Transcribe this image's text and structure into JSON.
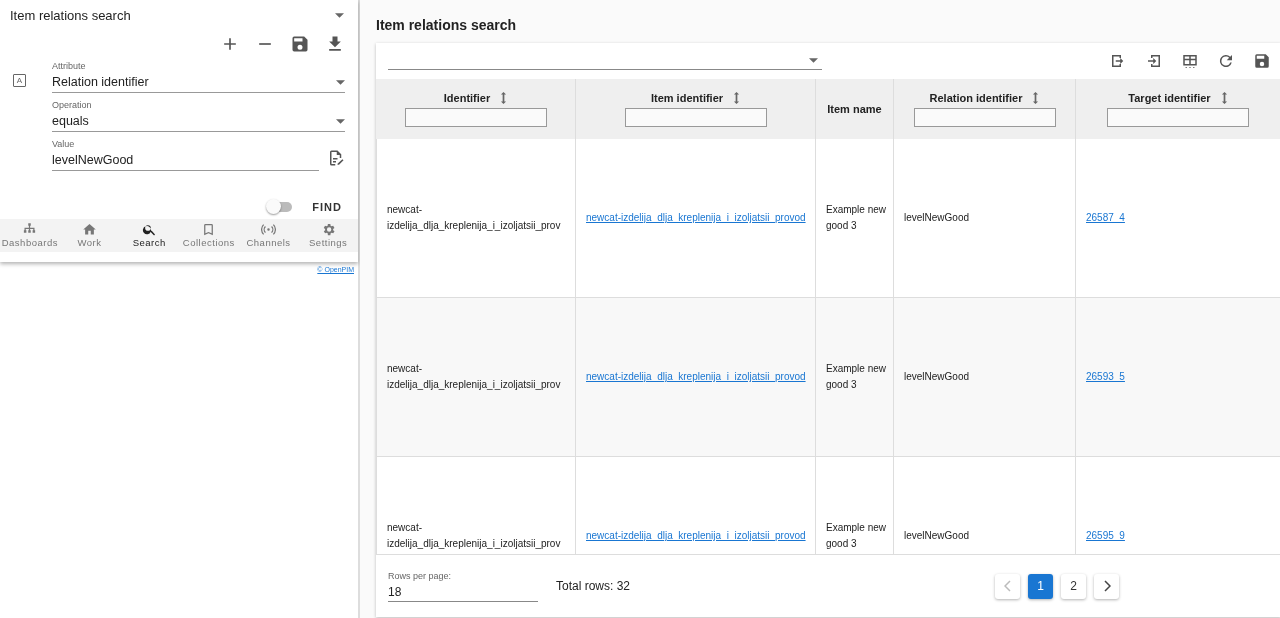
{
  "search_panel": {
    "search_name": "Item relations search",
    "attribute_type_badge": "A",
    "attribute": {
      "label": "Attribute",
      "value": "Relation identifier"
    },
    "operation": {
      "label": "Operation",
      "value": "equals"
    },
    "value_field": {
      "label": "Value",
      "value": "levelNewGood"
    },
    "toggle": {
      "on": false
    },
    "find_button": "FIND"
  },
  "bottom_nav": [
    {
      "label": "Dashboards",
      "kind": "sitemap",
      "selected": false
    },
    {
      "label": "Work",
      "kind": "home",
      "selected": false
    },
    {
      "label": "Search",
      "kind": "search",
      "selected": true
    },
    {
      "label": "Collections",
      "kind": "bookmark",
      "selected": false
    },
    {
      "label": "Channels",
      "kind": "broadcast",
      "selected": false
    },
    {
      "label": "Settings",
      "kind": "gear",
      "selected": false
    }
  ],
  "copyright": "© OpenPIM",
  "main": {
    "title": "Item relations search",
    "columns": [
      {
        "label": "Identifier",
        "sortable": true,
        "filter": true
      },
      {
        "label": "Item identifier",
        "sortable": true,
        "filter": true
      },
      {
        "label": "Item name",
        "sortable": false,
        "filter": false
      },
      {
        "label": "Relation identifier",
        "sortable": true,
        "filter": true
      },
      {
        "label": "Target identifier",
        "sortable": true,
        "filter": true
      }
    ],
    "rows": [
      {
        "identifier": "newcat-izdelija_dlja_kreplenija_i_izoljatsii_prov",
        "item_identifier": "newcat-izdelija_dlja_kreplenija_i_izoljatsii_provod",
        "item_name": "Example new good 3",
        "relation_identifier": "levelNewGood",
        "target_identifier": "26587_4"
      },
      {
        "identifier": "newcat-izdelija_dlja_kreplenija_i_izoljatsii_prov",
        "item_identifier": "newcat-izdelija_dlja_kreplenija_i_izoljatsii_provod",
        "item_name": "Example new good 3",
        "relation_identifier": "levelNewGood",
        "target_identifier": "26593_5"
      },
      {
        "identifier": "newcat-izdelija_dlja_kreplenija_i_izoljatsii_prov",
        "item_identifier": "newcat-izdelija_dlja_kreplenija_i_izoljatsii_provod",
        "item_name": "Example new good 3",
        "relation_identifier": "levelNewGood",
        "target_identifier": "26595_9"
      }
    ],
    "rows_per_page": {
      "label": "Rows per page:",
      "value": "18"
    },
    "total_rows": "Total rows: 32",
    "pages": [
      {
        "label": "1",
        "selected": true
      },
      {
        "label": "2",
        "selected": false
      }
    ]
  }
}
